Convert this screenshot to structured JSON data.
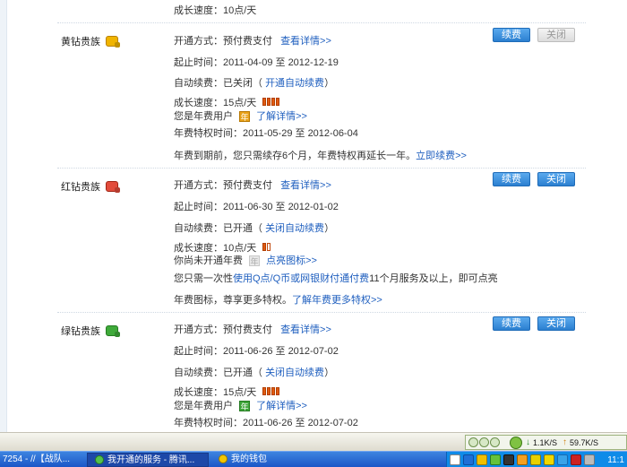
{
  "top_partial": {
    "label": "成长速度：",
    "value": "10点/天"
  },
  "services": [
    {
      "name": "黄钻贵族",
      "pay_label": "开通方式：",
      "pay_value": "预付费支付",
      "pay_link": "查看详情>>",
      "period_label": "起止时间：",
      "period_value": "2011-04-09 至 2012-12-19",
      "auto_label": "自动续费：",
      "auto_value": "已关闭（",
      "auto_link": "开通自动续费",
      "auto_tail": "）",
      "speed_label": "成长速度：",
      "speed_value": "15点/天",
      "year_text": "您是年费用户",
      "year_badge": "年",
      "year_link": "了解详情>>",
      "privilege_label": "年费特权时间：",
      "privilege_value": "2011-05-29 至 2012-06-04",
      "note_text": "年费到期前，您只需续存6个月，年费特权再延长一年。",
      "note_link": "立即续费>>",
      "renew_label": "续费",
      "close_label": "关闭",
      "close_enabled": false
    },
    {
      "name": "红钻贵族",
      "pay_label": "开通方式：",
      "pay_value": "预付费支付",
      "pay_link": "查看详情>>",
      "period_label": "起止时间：",
      "period_value": "2011-06-30 至 2012-01-02",
      "auto_label": "自动续费：",
      "auto_value": "已开通（",
      "auto_link": "关闭自动续费",
      "auto_tail": "）",
      "speed_label": "成长速度：",
      "speed_value": "10点/天",
      "year_text": "你尚未开通年费",
      "year_badge": "年",
      "year_link": "点亮图标>>",
      "note_prefix": "您只需一次性",
      "note_link1": "使用Q点/Q币或网银财付通付费",
      "note_mid": "11个月服务及以上，即可点亮",
      "note2_text": "年费图标，尊享更多特权。",
      "note2_link": "了解年费更多特权>>",
      "renew_label": "续费",
      "close_label": "关闭",
      "close_enabled": true
    },
    {
      "name": "绿钻贵族",
      "pay_label": "开通方式：",
      "pay_value": "预付费支付",
      "pay_link": "查看详情>>",
      "period_label": "起止时间：",
      "period_value": "2011-06-26 至 2012-07-02",
      "auto_label": "自动续费：",
      "auto_value": "已开通（",
      "auto_link": "关闭自动续费",
      "auto_tail": "）",
      "speed_label": "成长速度：",
      "speed_value": "15点/天",
      "year_text": "您是年费用户",
      "year_badge": "年",
      "year_link": "了解详情>>",
      "privilege_label": "年费特权时间：",
      "privilege_value": "2011-06-26 至 2012-07-02",
      "renew_label": "续费",
      "close_label": "关闭",
      "close_enabled": true
    }
  ],
  "tray": {
    "down_speed": "1.1K/S",
    "up_speed": "59.7K/S"
  },
  "taskbar": {
    "task1": "7254 - //【战队...",
    "task2": "我开通的服务 - 腾讯...",
    "task3": "我的钱包",
    "clock": "11:1"
  },
  "colors": {
    "accent": "#1f5fbf",
    "button_blue": "#2b7fd0",
    "taskbar": "#1b56c7"
  }
}
